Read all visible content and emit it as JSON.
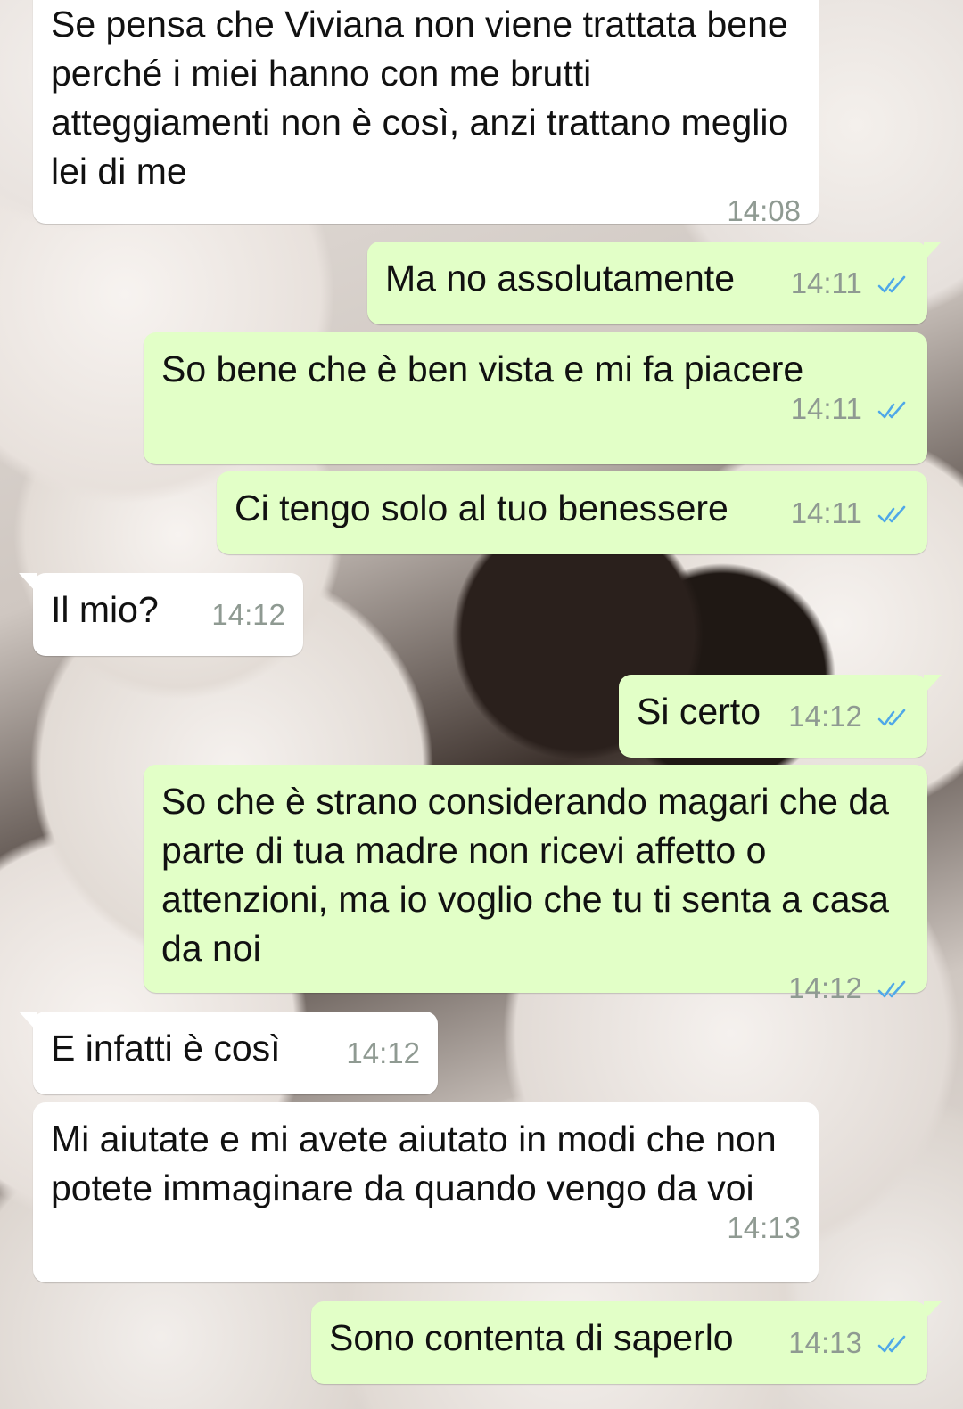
{
  "messages": [
    {
      "direction": "in",
      "text": "Se pensa che Viviana non viene trattata bene perché i miei hanno con me brutti atteggiamenti non è così, anzi trattano meglio lei di me",
      "time": "14:08"
    },
    {
      "direction": "out",
      "text": "Ma no assolutamente",
      "time": "14:11",
      "status": "read"
    },
    {
      "direction": "out",
      "text": "So bene che è ben vista e mi fa piacere",
      "time": "14:11",
      "status": "read"
    },
    {
      "direction": "out",
      "text": "Ci tengo solo al tuo benessere",
      "time": "14:11",
      "status": "read"
    },
    {
      "direction": "in",
      "text": "Il mio?",
      "time": "14:12"
    },
    {
      "direction": "out",
      "text": "Si certo",
      "time": "14:12",
      "status": "read"
    },
    {
      "direction": "out",
      "text": "So che è strano considerando magari che da parte di tua madre non ricevi affetto o attenzioni, ma io voglio che tu ti senta a casa da noi",
      "time": "14:12",
      "status": "read"
    },
    {
      "direction": "in",
      "text": "E infatti è così",
      "time": "14:12"
    },
    {
      "direction": "in",
      "text": "Mi aiutate e mi avete aiutato in modi che non potete immaginare da quando vengo da voi",
      "time": "14:13"
    },
    {
      "direction": "out",
      "text": "Sono contenta di saperlo",
      "time": "14:13",
      "status": "read"
    }
  ],
  "colors": {
    "incoming_bubble": "#ffffff",
    "outgoing_bubble": "#e2ffc7",
    "read_ticks": "#4fa8e8",
    "timestamp": "#8f9a92"
  },
  "icons": {
    "read_status": "double-check-icon"
  }
}
